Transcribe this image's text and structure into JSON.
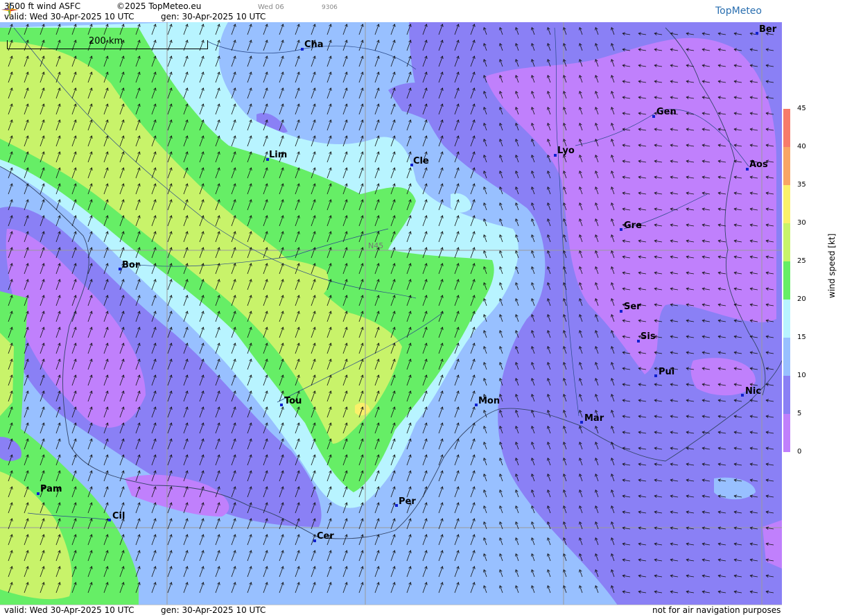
{
  "header": {
    "title": "3500 ft wind ASFC",
    "copyright": "©2025 TopMeteo.eu",
    "day_code": "Wed 06",
    "run_code": "9306",
    "valid": "valid:  Wed  30-Apr-2025  10 UTC",
    "generated": "gen: 30-Apr-2025 10 UTC"
  },
  "logo": {
    "text": "TopMeteo",
    "icon": "compass-star-icon"
  },
  "scale": {
    "label": "200 km"
  },
  "grid": {
    "label": "N45"
  },
  "cities": [
    {
      "label": "Ber"
    },
    {
      "label": "Cha"
    },
    {
      "label": "Gen"
    },
    {
      "label": "Lim"
    },
    {
      "label": "Cle"
    },
    {
      "label": "Lyo"
    },
    {
      "label": "Aos"
    },
    {
      "label": "Gre"
    },
    {
      "label": "Bor"
    },
    {
      "label": "Ser"
    },
    {
      "label": "Sis"
    },
    {
      "label": "Pui"
    },
    {
      "label": "Nic"
    },
    {
      "label": "Tou"
    },
    {
      "label": "Mon"
    },
    {
      "label": "Mar"
    },
    {
      "label": "Pam"
    },
    {
      "label": "Per"
    },
    {
      "label": "Cil"
    },
    {
      "label": "Cer"
    }
  ],
  "legend": {
    "title": "wind speed [kt]",
    "ticks": [
      "45",
      "40",
      "35",
      "30",
      "25",
      "20",
      "15",
      "10",
      "5",
      "0"
    ],
    "colors": [
      "#f77b6a",
      "#f8a565",
      "#faf06a",
      "#c8f36a",
      "#66ee66",
      "#b8f4ff",
      "#98c0ff",
      "#8a80f5",
      "#c080fc"
    ]
  },
  "footer": {
    "valid": "valid:  Wed  30-Apr-2025  10 UTC",
    "generated": "gen: 30-Apr-2025 10 UTC",
    "note": "not for air navigation purposes"
  }
}
